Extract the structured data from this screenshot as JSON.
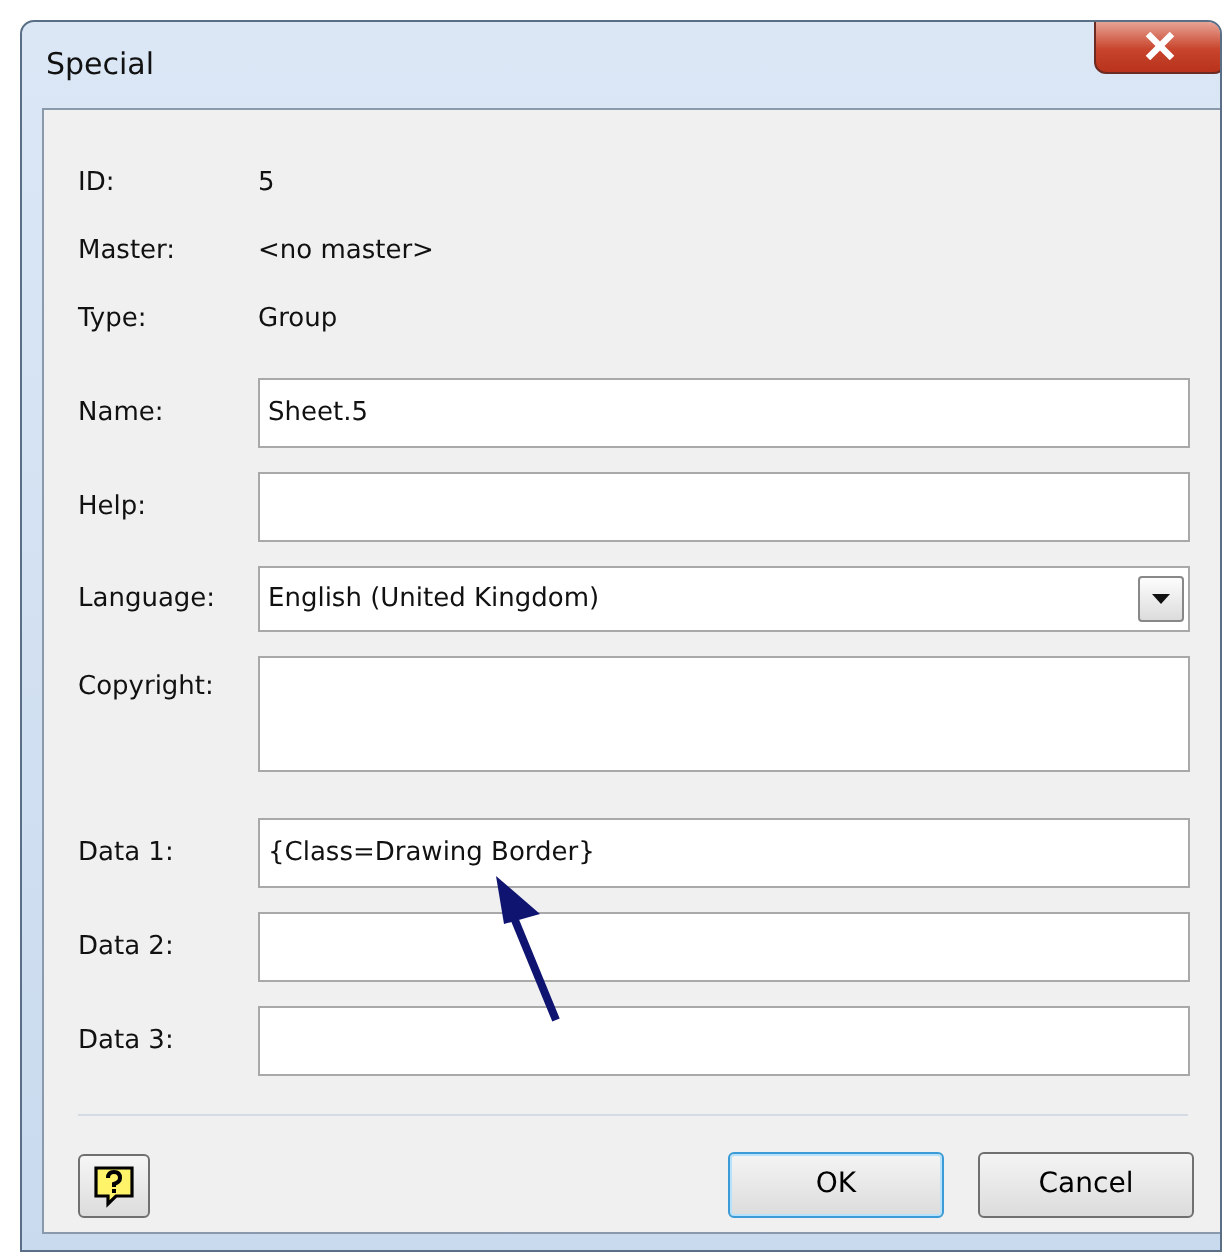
{
  "window": {
    "title": "Special"
  },
  "info": [
    {
      "label": "ID:",
      "value": "5"
    },
    {
      "label": "Master:",
      "value": "<no master>"
    },
    {
      "label": "Type:",
      "value": "Group"
    }
  ],
  "fields": [
    {
      "label": "Name:",
      "kind": "text",
      "value": "Sheet.5"
    },
    {
      "label": "Help:",
      "kind": "text"
    },
    {
      "label": "Language:",
      "kind": "dropdown",
      "value": "English (United Kingdom)"
    },
    {
      "label": "Copyright:",
      "kind": "textarea"
    },
    {
      "label": "Data 1:",
      "kind": "text",
      "value": "{Class=Drawing Border}"
    },
    {
      "label": "Data 2:",
      "kind": "text"
    },
    {
      "label": "Data 3:",
      "kind": "text"
    }
  ],
  "buttons": [
    {
      "label": "OK",
      "default": true
    },
    {
      "label": "Cancel",
      "default": false
    }
  ]
}
